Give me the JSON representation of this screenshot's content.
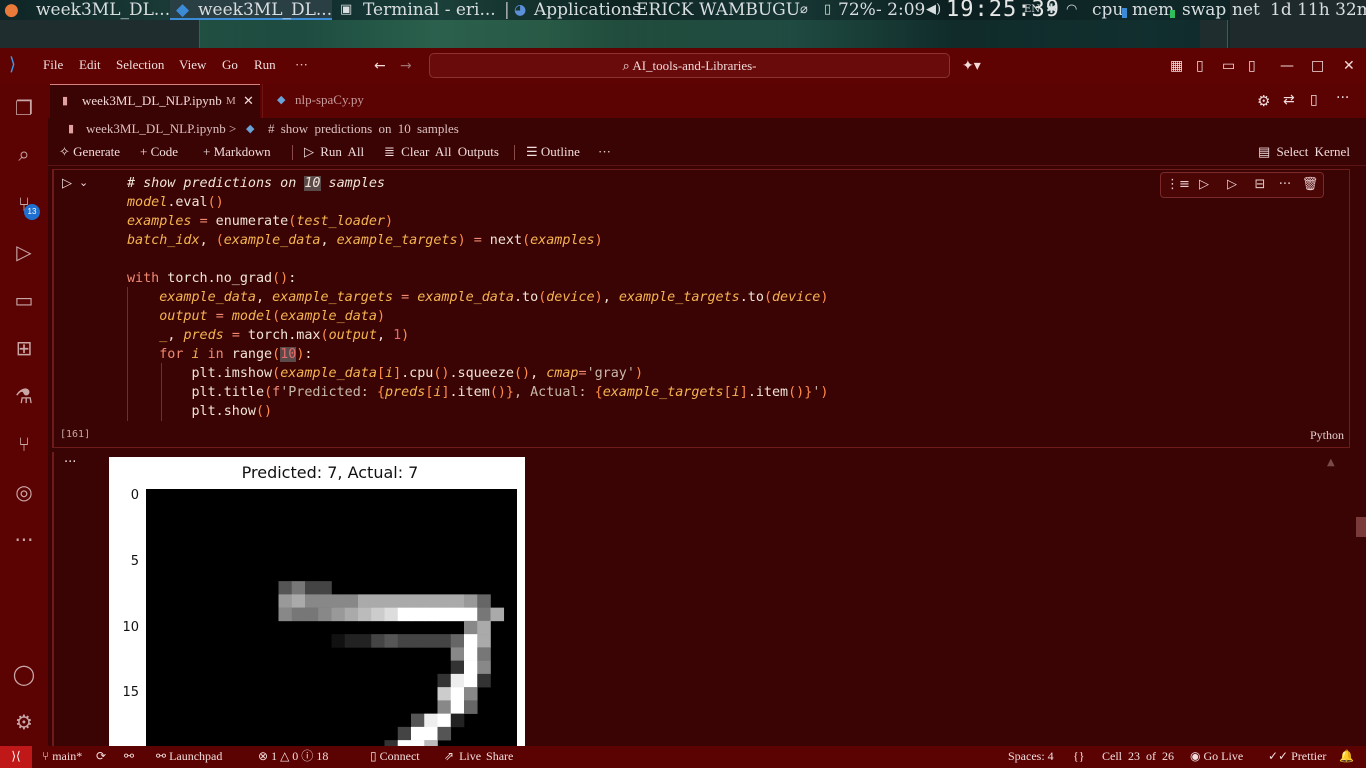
{
  "os_bar": {
    "tab1": "week3ML_DL...",
    "tab2": "week3ML_DL...",
    "tab3": "Terminal - eri...",
    "apps": "Applications",
    "user": "ERICK WAMBUGU",
    "battery": "72%",
    "battery_time": "- 2:09",
    "clock": "19:25:39",
    "lang": "EN",
    "cpu": "cpu",
    "mem": "mem",
    "swap": "swap",
    "net": "net",
    "uptime": "1d 11h 32m"
  },
  "titlebar": {
    "menus": [
      "File",
      "Edit",
      "Selection",
      "View",
      "Go",
      "Run",
      "···"
    ],
    "search": "AI_tools-and-Libraries-"
  },
  "tabs": [
    {
      "label": "week3ML_DL_NLP.ipynb",
      "modified": "M"
    },
    {
      "label": "nlp-spaCy.py"
    }
  ],
  "breadcrumb": {
    "file": "week3ML_DL_NLP.ipynb",
    "sep": ">",
    "cell": "# show predictions on 10 samples"
  },
  "toolbar": {
    "generate": "Generate",
    "code": "Code",
    "markdown": "Markdown",
    "run_all": "Run All",
    "clear": "Clear All Outputs",
    "outline": "Outline",
    "more": "···",
    "kernel": "Select Kernel"
  },
  "activity": {
    "source_control_badge": "13"
  },
  "cell": {
    "exec_count": "[161]",
    "language": "Python",
    "output_ellipsis": "···"
  },
  "figure": {
    "title": "Predicted: 7, Actual: 7",
    "yticks": [
      "0",
      "5",
      "10",
      "15"
    ],
    "image_rows": [
      "0000000000000000000000000000",
      "0000000000000000000000000000",
      "0000000000000000000000000000",
      "0000000000000000000000000000",
      "0000000000000000000000000000",
      "0000000000000000000000000000",
      "0000000000000000000000000000",
      "0000000000574400000000000000",
      "00000000009a8888aaaaaaaa9600",
      "000000000087789abcdffffff7a0",
      "0000000000000000000000008a00",
      "000000000000001224544446fa00",
      "000000000000000000000008f700",
      "000000000000000000000003f800",
      "00000000000000000000003ef300",
      "0000000000000000000000cf8000",
      "00000000000000000000008f6000",
      "000000000000000000005ef20000",
      "00000000000000000004ff500000",
      "0000000000000000003ffb000000"
    ]
  },
  "statusbar": {
    "branch": "main*",
    "launchpad": "Launchpad",
    "errors": "1",
    "warnings": "0",
    "infos": "18",
    "connect": "Connect",
    "live_share": "Live Share",
    "spaces": "Spaces: 4",
    "braces": "{}",
    "cell": "Cell 23 of 26",
    "go_live": "Go Live",
    "prettier": "Prettier"
  }
}
